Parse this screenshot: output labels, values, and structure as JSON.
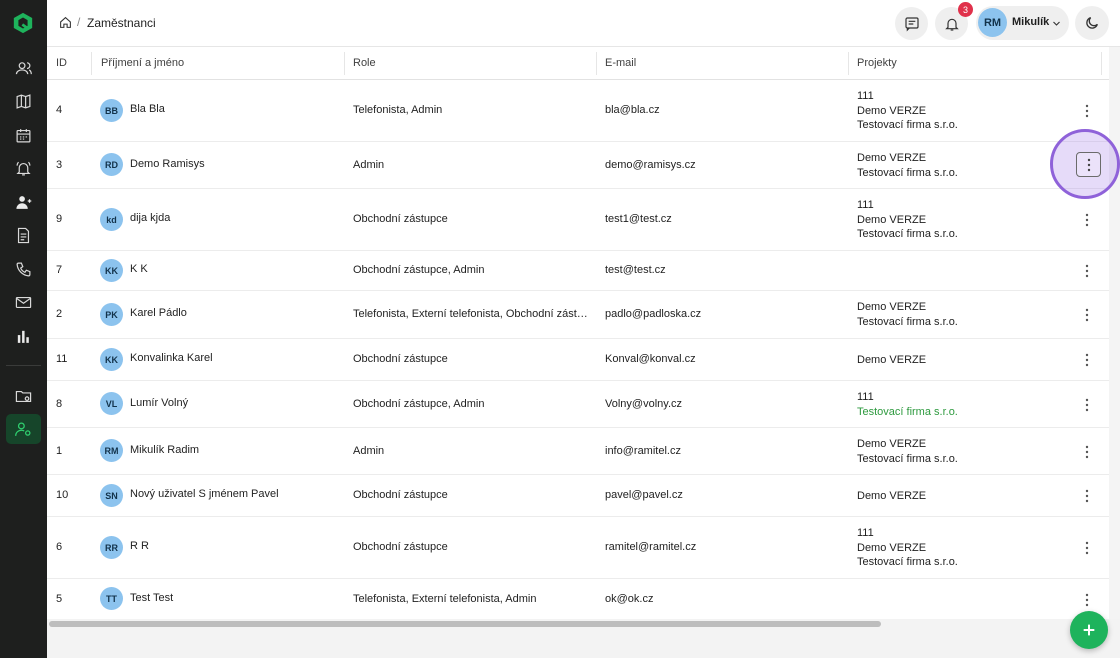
{
  "breadcrumb": {
    "title": "Zaměstnanci"
  },
  "header": {
    "notification_count": "3",
    "user": {
      "initials": "RM",
      "name": "Mikulík"
    }
  },
  "table": {
    "columns": [
      "ID",
      "Příjmení a jméno",
      "Role",
      "E-mail",
      "Projekty"
    ],
    "rows": [
      {
        "id": "4",
        "initials": "BB",
        "name": "Bla Bla",
        "role": "Telefonista, Admin",
        "email": "bla@bla.cz",
        "projects": [
          "111",
          "Demo VERZE",
          "Testovací firma s.r.o."
        ]
      },
      {
        "id": "3",
        "initials": "RD",
        "name": "Demo Ramisys",
        "role": "Admin",
        "email": "demo@ramisys.cz",
        "projects": [
          "Demo VERZE",
          "Testovací firma s.r.o."
        ]
      },
      {
        "id": "9",
        "initials": "kd",
        "name": "dija kjda",
        "role": "Obchodní zástupce",
        "email": "test1@test.cz",
        "projects": [
          "111",
          "Demo VERZE",
          "Testovací firma s.r.o."
        ]
      },
      {
        "id": "7",
        "initials": "KK",
        "name": "K K",
        "role": "Obchodní zástupce, Admin",
        "email": "test@test.cz",
        "projects": []
      },
      {
        "id": "2",
        "initials": "PK",
        "name": "Karel Pádlo",
        "role": "Telefonista, Externí telefonista, Obchodní zást…",
        "email": "padlo@padloska.cz",
        "projects": [
          "Demo VERZE",
          "Testovací firma s.r.o."
        ]
      },
      {
        "id": "11",
        "initials": "KK",
        "name": "Konvalinka Karel",
        "role": "Obchodní zástupce",
        "email": "Konval@konval.cz",
        "projects": [
          "Demo VERZE"
        ]
      },
      {
        "id": "8",
        "initials": "VL",
        "name": "Lumír Volný",
        "role": "Obchodní zástupce, Admin",
        "email": "Volny@volny.cz",
        "projects": [
          "111",
          "Testovací firma s.r.o."
        ]
      },
      {
        "id": "1",
        "initials": "RM",
        "name": "Mikulík Radim",
        "role": "Admin",
        "email": "info@ramitel.cz",
        "projects": [
          "Demo VERZE",
          "Testovací firma s.r.o."
        ]
      },
      {
        "id": "10",
        "initials": "SN",
        "name": "Nový uživatel S jménem Pavel",
        "role": "Obchodní zástupce",
        "email": "pavel@pavel.cz",
        "projects": [
          "Demo VERZE"
        ]
      },
      {
        "id": "6",
        "initials": "RR",
        "name": "R R",
        "role": "Obchodní zástupce",
        "email": "ramitel@ramitel.cz",
        "projects": [
          "111",
          "Demo VERZE",
          "Testovací firma s.r.o."
        ]
      },
      {
        "id": "5",
        "initials": "TT",
        "name": "Test Test",
        "role": "Telefonista, Externí telefonista, Admin",
        "email": "ok@ok.cz",
        "projects": []
      }
    ]
  },
  "colors": {
    "accent": "#1eb35c",
    "avatar": "#8cc3ee",
    "badge": "#e0314b",
    "highlight_project": "#2e9a3f",
    "focus": "#8f62d9"
  },
  "icons": [
    "logo-icon",
    "users-icon",
    "map-icon",
    "calendar-icon",
    "bell-alert-icon",
    "user-add-icon",
    "document-icon",
    "phone-icon",
    "mail-icon",
    "chart-icon",
    "folder-settings-icon",
    "user-settings-icon",
    "home-icon",
    "chat-icon",
    "bell-icon",
    "chevron-down-icon",
    "moon-icon",
    "kebab-icon",
    "plus-icon"
  ]
}
